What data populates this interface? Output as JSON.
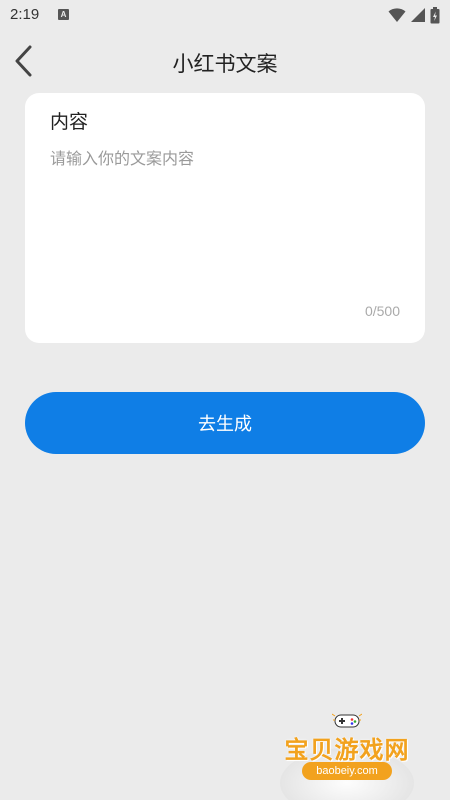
{
  "status_bar": {
    "time": "2:19",
    "notification_icon": "a-icon",
    "icons": [
      "wifi-icon",
      "signal-icon",
      "battery-icon"
    ]
  },
  "header": {
    "back_icon": "chevron-left-icon",
    "title": "小红书文案"
  },
  "content": {
    "label": "内容",
    "value": "",
    "placeholder": "请输入你的文案内容",
    "char_count": "0/500"
  },
  "generate_button": {
    "label": "去生成"
  },
  "watermark": {
    "title": "宝贝游戏网",
    "url": "baobeiy.com",
    "icon": "gamepad-icon"
  },
  "colors": {
    "background": "#ebebeb",
    "card": "#ffffff",
    "accent": "#0f7ee6",
    "watermark": "#f2a21e"
  }
}
